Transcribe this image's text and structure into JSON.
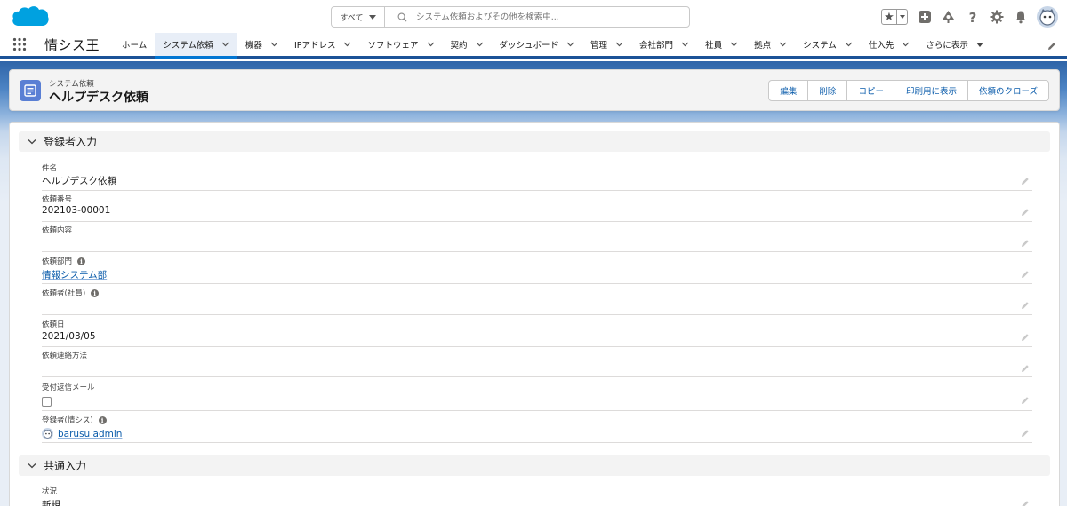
{
  "global_header": {
    "search": {
      "scope": "すべて",
      "placeholder": "システム依頼およびその他を検索中..."
    },
    "icons": [
      "favorites-star-icon",
      "add-icon",
      "trailhead-icon",
      "help-icon",
      "settings-gear-icon",
      "notification-bell-icon",
      "user-avatar"
    ]
  },
  "nav": {
    "app_name": "情シス王",
    "items": [
      {
        "label": "ホーム",
        "chevron": false,
        "active": false
      },
      {
        "label": "システム依頼",
        "chevron": true,
        "active": true
      },
      {
        "label": "機器",
        "chevron": true,
        "active": false
      },
      {
        "label": "IPアドレス",
        "chevron": true,
        "active": false
      },
      {
        "label": "ソフトウェア",
        "chevron": true,
        "active": false
      },
      {
        "label": "契約",
        "chevron": true,
        "active": false
      },
      {
        "label": "ダッシュボード",
        "chevron": true,
        "active": false
      },
      {
        "label": "管理",
        "chevron": true,
        "active": false
      },
      {
        "label": "会社部門",
        "chevron": true,
        "active": false
      },
      {
        "label": "社員",
        "chevron": true,
        "active": false
      },
      {
        "label": "拠点",
        "chevron": true,
        "active": false
      },
      {
        "label": "システム",
        "chevron": true,
        "active": false
      },
      {
        "label": "仕入先",
        "chevron": true,
        "active": false
      }
    ],
    "more_label": "さらに表示"
  },
  "record": {
    "object_type": "システム依頼",
    "title": "ヘルプデスク依頼",
    "actions": [
      "編集",
      "削除",
      "コピー",
      "印刷用に表示",
      "依頼のクローズ"
    ]
  },
  "sections": {
    "registrant": {
      "title": "登録者入力",
      "fields": {
        "subject": {
          "label": "件名",
          "value": "ヘルプデスク依頼"
        },
        "request_number": {
          "label": "依頼番号",
          "value": "202103-00001"
        },
        "request_content": {
          "label": "依頼内容",
          "value": ""
        },
        "request_department": {
          "label": "依頼部門",
          "value": "情報システム部"
        },
        "requester": {
          "label": "依頼者(社員)",
          "value": ""
        },
        "request_date": {
          "label": "依頼日",
          "value": "2021/03/05"
        },
        "contact_method": {
          "label": "依頼連絡方法",
          "value": ""
        },
        "reply_mail": {
          "label": "受付返信メール",
          "checked": false
        },
        "registered_by": {
          "label": "登録者(情シス)",
          "value": "barusu admin"
        }
      }
    },
    "common": {
      "title": "共通入力",
      "fields": {
        "status": {
          "label": "状況",
          "value": "新規"
        }
      }
    }
  },
  "colors": {
    "brand_blue": "#0176d3",
    "link_blue": "#0b5cab",
    "nav_border": "#1b5297",
    "record_icon": "#5a7fd4"
  }
}
